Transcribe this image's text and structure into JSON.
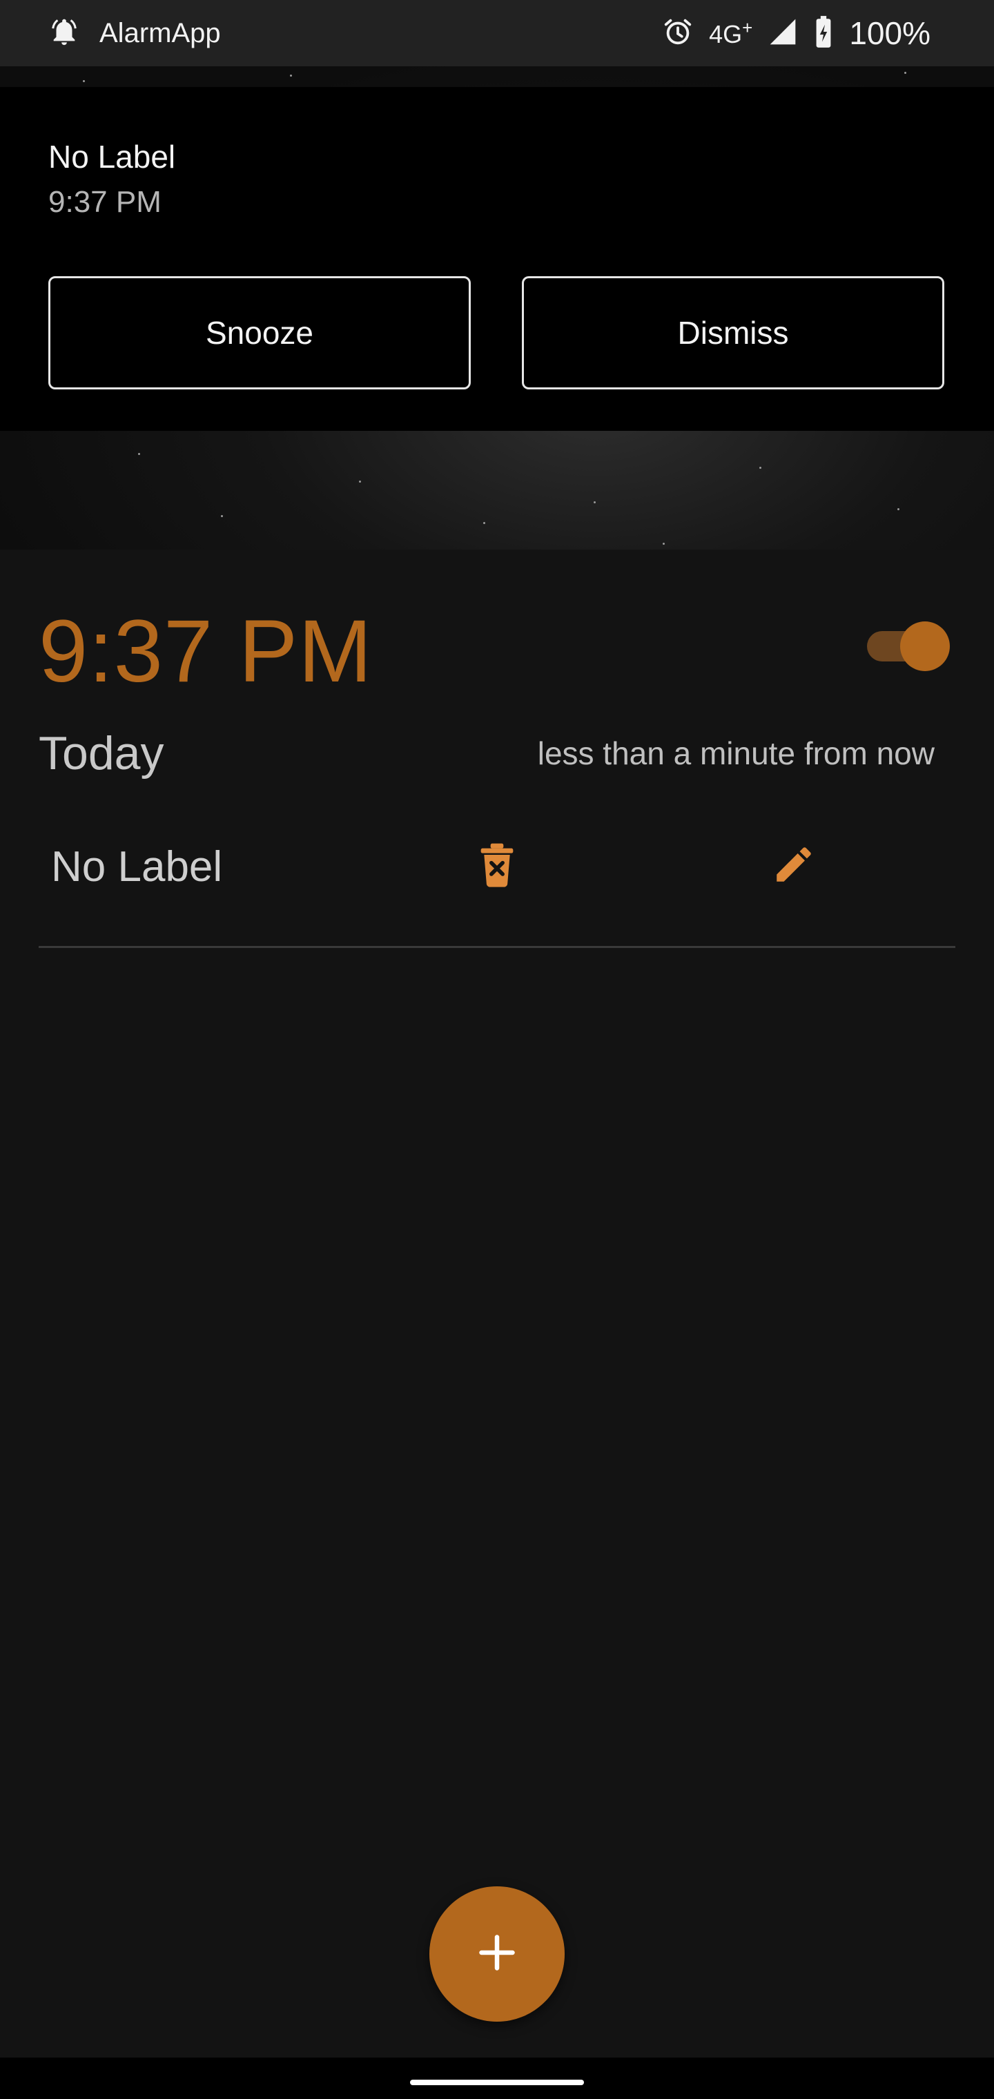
{
  "status_bar": {
    "app_name": "AlarmApp",
    "network": "4G",
    "network_sup": "+",
    "battery": "100%"
  },
  "notification": {
    "title": "No Label",
    "time": "9:37 PM",
    "snooze_label": "Snooze",
    "dismiss_label": "Dismiss"
  },
  "alarm": {
    "time": "9:37 PM",
    "enabled": true,
    "day": "Today",
    "relative": "less than a minute from now",
    "label": "No Label"
  },
  "colors": {
    "accent": "#b3681d",
    "background": "#131313"
  },
  "icons": {
    "notification_bell": "bell-ringing-icon",
    "alarm_clock": "alarm-clock-icon",
    "signal": "signal-icon",
    "battery": "battery-charging-icon",
    "delete": "trash-icon",
    "edit": "pencil-icon",
    "add": "plus-icon"
  }
}
